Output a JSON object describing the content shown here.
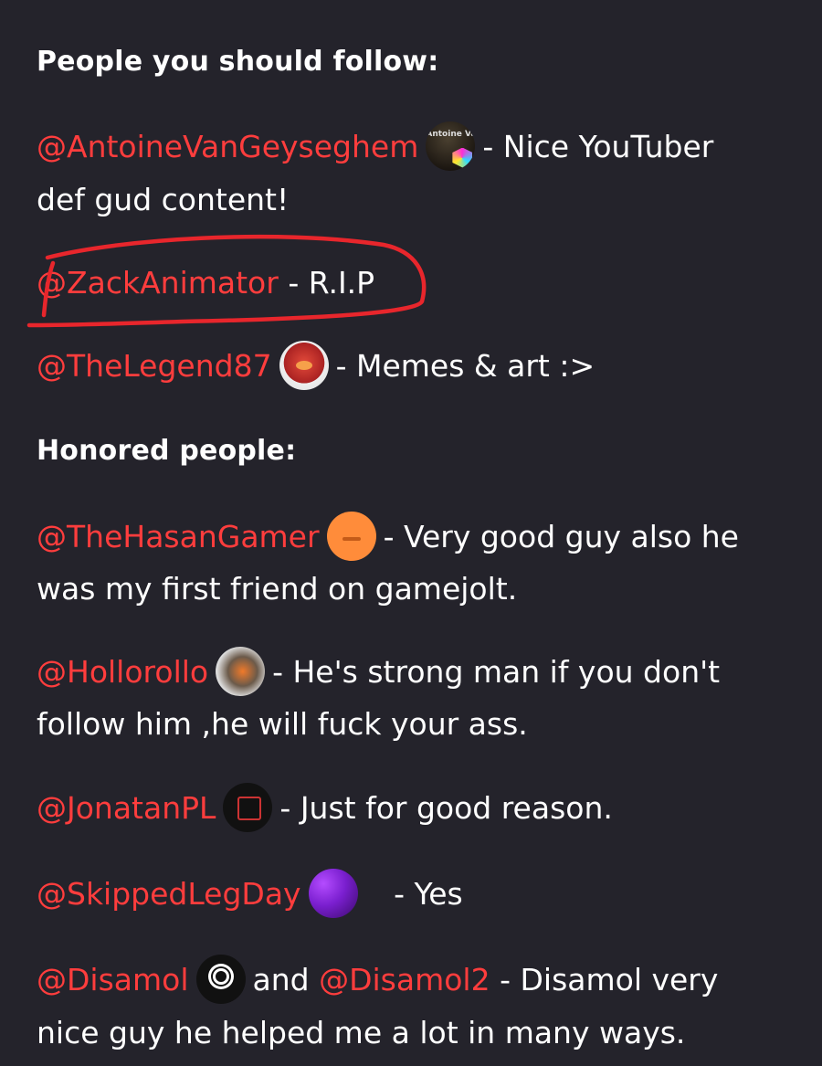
{
  "sections": {
    "follow_heading": "People you should follow:",
    "honored_heading": "Honored people:"
  },
  "follow": [
    {
      "mention": "@AntoineVanGeyseghem",
      "avatar_text": "Antoine Van Gey",
      "text": "- Nice YouTuber",
      "text2": "def gud content!"
    },
    {
      "mention": "@ZackAnimator",
      "text": "- R.I.P"
    },
    {
      "mention": "@TheLegend87",
      "text": "- Memes & art :>"
    }
  ],
  "honored": [
    {
      "mention": "@TheHasanGamer",
      "text": "- Very good guy also he",
      "text2": "was my first friend on gamejolt."
    },
    {
      "mention": "@Hollorollo",
      "text": "- He's strong man if you don't",
      "text2": "follow him ,he will fuck your ass."
    },
    {
      "mention": "@JonatanPL",
      "text": "- Just for good reason."
    },
    {
      "mention": "@SkippedLegDay",
      "text": "- Yes"
    },
    {
      "mention": "@Disamol",
      "and": "and",
      "mention2": "@Disamol2",
      "text": "- Disamol very",
      "text2": "nice guy he helped me a lot in many ways."
    }
  ],
  "colors": {
    "background": "#24232b",
    "mention": "#ff3d3d",
    "text": "#ffffff",
    "annotation": "#e8262c"
  }
}
